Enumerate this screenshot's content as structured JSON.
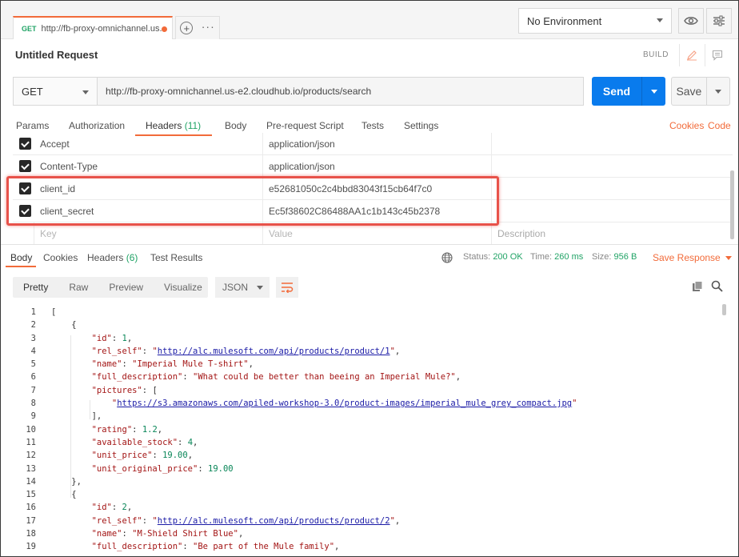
{
  "tab": {
    "method": "GET",
    "url": "http://fb-proxy-omnichannel.us...",
    "unsaved": true
  },
  "environment": {
    "selected": "No Environment"
  },
  "request": {
    "title": "Untitled Request",
    "build_label": "BUILD",
    "method": "GET",
    "url": "http://fb-proxy-omnichannel.us-e2.cloudhub.io/products/search",
    "send_label": "Send",
    "save_label": "Save"
  },
  "request_tabs": [
    {
      "label": "Params"
    },
    {
      "label": "Authorization"
    },
    {
      "label": "Headers",
      "count": "(11)"
    },
    {
      "label": "Body"
    },
    {
      "label": "Pre-request Script"
    },
    {
      "label": "Tests"
    },
    {
      "label": "Settings"
    }
  ],
  "right_links": {
    "cookies": "Cookies",
    "code": "Code"
  },
  "headers": [
    {
      "key": "Accept",
      "value": "application/json"
    },
    {
      "key": "Content-Type",
      "value": "application/json"
    },
    {
      "key": "client_id",
      "value": "e52681050c2c4bbd83043f15cb64f7c0"
    },
    {
      "key": "client_secret",
      "value": "Ec5f38602C86488AA1c1b143c45b2378"
    }
  ],
  "header_placeholders": {
    "key": "Key",
    "value": "Value",
    "description": "Description"
  },
  "response": {
    "tabs": [
      {
        "label": "Body"
      },
      {
        "label": "Cookies"
      },
      {
        "label": "Headers",
        "count": "(6)"
      },
      {
        "label": "Test Results"
      }
    ],
    "status_label": "Status:",
    "status_value": "200 OK",
    "time_label": "Time:",
    "time_value": "260 ms",
    "size_label": "Size:",
    "size_value": "956 B",
    "save_label": "Save Response",
    "views": [
      "Pretty",
      "Raw",
      "Preview",
      "Visualize"
    ],
    "format": "JSON"
  },
  "code_lines": [
    {
      "n": "1",
      "t": "["
    },
    {
      "n": "2",
      "t": "    {"
    },
    {
      "n": "3",
      "t": "        \"id\": 1,"
    },
    {
      "n": "4",
      "t": "        \"rel_self\": \"http://alc.mulesoft.com/api/products/product/1\","
    },
    {
      "n": "5",
      "t": "        \"name\": \"Imperial Mule T-shirt\","
    },
    {
      "n": "6",
      "t": "        \"full_description\": \"What could be better than beeing an Imperial Mule?\","
    },
    {
      "n": "7",
      "t": "        \"pictures\": ["
    },
    {
      "n": "8",
      "t": "            \"https://s3.amazonaws.com/apiled-workshop-3.0/product-images/imperial_mule_grey_compact.jpg\""
    },
    {
      "n": "9",
      "t": "        ],"
    },
    {
      "n": "10",
      "t": "        \"rating\": 1.2,"
    },
    {
      "n": "11",
      "t": "        \"available_stock\": 4,"
    },
    {
      "n": "12",
      "t": "        \"unit_price\": 19.00,"
    },
    {
      "n": "13",
      "t": "        \"unit_original_price\": 19.00"
    },
    {
      "n": "14",
      "t": "    },"
    },
    {
      "n": "15",
      "t": "    {"
    },
    {
      "n": "16",
      "t": "        \"id\": 2,"
    },
    {
      "n": "17",
      "t": "        \"rel_self\": \"http://alc.mulesoft.com/api/products/product/2\","
    },
    {
      "n": "18",
      "t": "        \"name\": \"M-Shield Shirt Blue\","
    },
    {
      "n": "19",
      "t": "        \"full_description\": \"Be part of the Mule family\","
    }
  ],
  "colors": {
    "accent": "#f26b3a",
    "send": "#097bed",
    "success": "#21a366",
    "highlight": "#e8524a"
  }
}
